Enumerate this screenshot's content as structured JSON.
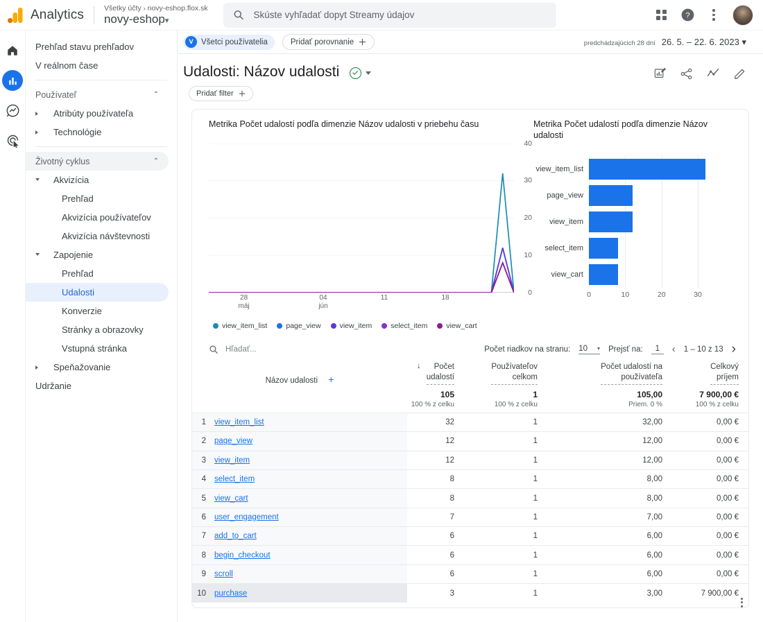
{
  "topbar": {
    "brand": "Analytics",
    "breadcrumb_root": "Všetky účty",
    "breadcrumb_sep": "›",
    "breadcrumb_property": "novy-eshop.flox.sk",
    "account_name": "novy-eshop",
    "account_caret": "▾",
    "search_placeholder": "Skúste vyhľadať dopyt Streamy údajov",
    "search_value": "",
    "icons": {
      "search": "search-icon",
      "apps": "apps-grid-icon",
      "help": "help-icon",
      "more": "more-vert-icon",
      "avatar": "user-avatar"
    }
  },
  "rail": {
    "items": [
      {
        "name": "home",
        "icon": "home-icon",
        "active": false
      },
      {
        "name": "reports",
        "icon": "bar-chart-icon",
        "active": true
      },
      {
        "name": "explore",
        "icon": "explore-icon",
        "active": false
      },
      {
        "name": "advertising",
        "icon": "advertising-target-icon",
        "active": false
      }
    ]
  },
  "sidebar": {
    "items": [
      {
        "label": "Prehľad stavu prehľadov",
        "level": "lvl1",
        "type": "link"
      },
      {
        "label": "V reálnom čase",
        "level": "lvl1",
        "type": "link"
      },
      {
        "label": "",
        "type": "separator"
      },
      {
        "label": "Používateľ",
        "level": "section",
        "type": "section",
        "chevron": "⌃",
        "shaded": false
      },
      {
        "label": "Atribúty používateľa",
        "level": "lvl2",
        "type": "expandable",
        "expanded": false
      },
      {
        "label": "Technológie",
        "level": "lvl2",
        "type": "expandable",
        "expanded": false
      },
      {
        "label": "",
        "type": "separator"
      },
      {
        "label": "Životný cyklus",
        "level": "section",
        "type": "section",
        "chevron": "⌃",
        "shaded": true
      },
      {
        "label": "Akvizícia",
        "level": "lvl2",
        "type": "expandable",
        "expanded": true
      },
      {
        "label": "Prehľad",
        "level": "sub",
        "type": "link"
      },
      {
        "label": "Akvizícia používateľov",
        "level": "sub",
        "type": "link"
      },
      {
        "label": "Akvizícia návštevnosti",
        "level": "sub",
        "type": "link"
      },
      {
        "label": "Zapojenie",
        "level": "lvl2",
        "type": "expandable",
        "expanded": true,
        "shaded": true
      },
      {
        "label": "Prehľad",
        "level": "sub",
        "type": "link"
      },
      {
        "label": "Udalosti",
        "level": "sub",
        "type": "link",
        "selected": true
      },
      {
        "label": "Konverzie",
        "level": "sub",
        "type": "link"
      },
      {
        "label": "Stránky a obrazovky",
        "level": "sub",
        "type": "link"
      },
      {
        "label": "Vstupná stránka",
        "level": "sub",
        "type": "link"
      },
      {
        "label": "Speňažovanie",
        "level": "lvl2",
        "type": "expandable",
        "expanded": false
      },
      {
        "label": "Udržanie",
        "level": "lvl1",
        "type": "link"
      }
    ]
  },
  "comparison_bar": {
    "audience_chip": "Všetci používatelia",
    "audience_initial": "V",
    "add_comparison": "Pridať porovnanie",
    "add_comparison_icon": "plus-icon",
    "date_prefix": "predchádzajúcich 28 dní",
    "date_range": "26. 5. – 22. 6. 2023",
    "date_caret": "▾"
  },
  "page_header": {
    "title": "Udalosti: Názov udalosti",
    "validated_icon": "check-circle-icon",
    "dropdown_icon": "caret-down-icon",
    "add_filter": "Pridať filter",
    "add_filter_icon": "plus-icon",
    "actions": [
      {
        "name": "insights-icon"
      },
      {
        "name": "share-icon"
      },
      {
        "name": "trend-analysis-icon"
      },
      {
        "name": "edit-pencil-icon"
      }
    ]
  },
  "colors": {
    "accent_blue": "#1a73e8",
    "link_blue": "#1a73e8",
    "bar_blue": "#1a73e8",
    "series": [
      "#1a8cb3",
      "#1a73e8",
      "#5a3bd8",
      "#8430ce",
      "#8e1b8e"
    ]
  },
  "chart_data": [
    {
      "type": "line",
      "title": "Metrika Počet udalostí podľa dimenzie Názov udalosti v priebehu času",
      "xlabel": "",
      "ylabel": "",
      "ylim": [
        0,
        40
      ],
      "yticks": [
        0,
        10,
        20,
        30,
        40
      ],
      "grid": true,
      "legend_position": "bottom",
      "xticks": [
        {
          "label": "28",
          "sub": "máj",
          "pos": 0.115
        },
        {
          "label": "04",
          "sub": "jún",
          "pos": 0.375
        },
        {
          "label": "11",
          "sub": "",
          "pos": 0.575
        },
        {
          "label": "18",
          "sub": "",
          "pos": 0.775
        }
      ],
      "x": [
        "26.5",
        "27.5",
        "28.5",
        "29.5",
        "30.5",
        "31.5",
        "01.6",
        "02.6",
        "03.6",
        "04.6",
        "05.6",
        "06.6",
        "07.6",
        "08.6",
        "09.6",
        "10.6",
        "11.6",
        "12.6",
        "13.6",
        "14.6",
        "15.6",
        "16.6",
        "17.6",
        "18.6",
        "19.6",
        "20.6",
        "21.6",
        "22.6"
      ],
      "series": [
        {
          "name": "view_item_list",
          "color": "#1a8cb3",
          "values": [
            0,
            0,
            0,
            0,
            0,
            0,
            0,
            0,
            0,
            0,
            0,
            0,
            0,
            0,
            0,
            0,
            0,
            0,
            0,
            0,
            0,
            0,
            0,
            0,
            0,
            0,
            32,
            0
          ]
        },
        {
          "name": "page_view",
          "color": "#1a73e8",
          "values": [
            0,
            0,
            0,
            0,
            0,
            0,
            0,
            0,
            0,
            0,
            0,
            0,
            0,
            0,
            0,
            0,
            0,
            0,
            0,
            0,
            0,
            0,
            0,
            0,
            0,
            0,
            12,
            0
          ]
        },
        {
          "name": "view_item",
          "color": "#5a3bd8",
          "values": [
            0,
            0,
            0,
            0,
            0,
            0,
            0,
            0,
            0,
            0,
            0,
            0,
            0,
            0,
            0,
            0,
            0,
            0,
            0,
            0,
            0,
            0,
            0,
            0,
            0,
            0,
            12,
            0
          ]
        },
        {
          "name": "select_item",
          "color": "#8430ce",
          "values": [
            0,
            0,
            0,
            0,
            0,
            0,
            0,
            0,
            0,
            0,
            0,
            0,
            0,
            0,
            0,
            0,
            0,
            0,
            0,
            0,
            0,
            0,
            0,
            0,
            0,
            0,
            8,
            0
          ]
        },
        {
          "name": "view_cart",
          "color": "#8e1b8e",
          "values": [
            0,
            0,
            0,
            0,
            0,
            0,
            0,
            0,
            0,
            0,
            0,
            0,
            0,
            0,
            0,
            0,
            0,
            0,
            0,
            0,
            0,
            0,
            0,
            0,
            0,
            0,
            8,
            0
          ]
        }
      ]
    },
    {
      "type": "bar",
      "orientation": "horizontal",
      "title": "Metrika Počet udalostí podľa dimenzie Názov udalosti",
      "categories": [
        "view_item_list",
        "page_view",
        "view_item",
        "select_item",
        "view_cart"
      ],
      "values": [
        32,
        12,
        12,
        8,
        8
      ],
      "xlim": [
        0,
        34
      ],
      "xticks": [
        0,
        10,
        20,
        30
      ],
      "color": "#1a73e8",
      "grid": true
    }
  ],
  "table_controls": {
    "search_icon": "search-icon",
    "search_placeholder": "Hľadať...",
    "search_value": "",
    "rows_per_page_label": "Počet riadkov na stranu:",
    "rows_per_page_value": "10",
    "rows_per_page_caret": "▾",
    "goto_label": "Prejsť na:",
    "goto_value": "1",
    "range_label": "1 – 10 z 13",
    "prev_icon": "chevron-left-icon",
    "next_icon": "chevron-right-icon"
  },
  "table": {
    "dimension_header": "Názov udalosti",
    "add_dimension_icon": "plus-icon",
    "sort_icon": "arrow-down-icon",
    "columns": [
      {
        "line1": "Počet",
        "line2": "udalostí"
      },
      {
        "line1": "Používateľov",
        "line2": "celkom"
      },
      {
        "line1": "Počet udalostí na",
        "line2": "používateľa"
      },
      {
        "line1": "Celkový",
        "line2": "príjem"
      }
    ],
    "totals": [
      {
        "value": "105",
        "sub": "100 % z celku"
      },
      {
        "value": "1",
        "sub": "100 % z celku"
      },
      {
        "value": "105,00",
        "sub": "Priem. 0 %"
      },
      {
        "value": "7 900,00 €",
        "sub": "100 % z celku"
      }
    ],
    "rows": [
      {
        "idx": "1",
        "name": "view_item_list",
        "events": "32",
        "users": "1",
        "per_user": "32,00",
        "revenue": "0,00 €"
      },
      {
        "idx": "2",
        "name": "page_view",
        "events": "12",
        "users": "1",
        "per_user": "12,00",
        "revenue": "0,00 €"
      },
      {
        "idx": "3",
        "name": "view_item",
        "events": "12",
        "users": "1",
        "per_user": "12,00",
        "revenue": "0,00 €"
      },
      {
        "idx": "4",
        "name": "select_item",
        "events": "8",
        "users": "1",
        "per_user": "8,00",
        "revenue": "0,00 €"
      },
      {
        "idx": "5",
        "name": "view_cart",
        "events": "8",
        "users": "1",
        "per_user": "8,00",
        "revenue": "0,00 €"
      },
      {
        "idx": "6",
        "name": "user_engagement",
        "events": "7",
        "users": "1",
        "per_user": "7,00",
        "revenue": "0,00 €"
      },
      {
        "idx": "7",
        "name": "add_to_cart",
        "events": "6",
        "users": "1",
        "per_user": "6,00",
        "revenue": "0,00 €"
      },
      {
        "idx": "8",
        "name": "begin_checkout",
        "events": "6",
        "users": "1",
        "per_user": "6,00",
        "revenue": "0,00 €"
      },
      {
        "idx": "9",
        "name": "scroll",
        "events": "6",
        "users": "1",
        "per_user": "6,00",
        "revenue": "0,00 €"
      },
      {
        "idx": "10",
        "name": "purchase",
        "events": "3",
        "users": "1",
        "per_user": "3,00",
        "revenue": "7 900,00 €",
        "menu_icon": "more-vert-icon"
      }
    ]
  }
}
